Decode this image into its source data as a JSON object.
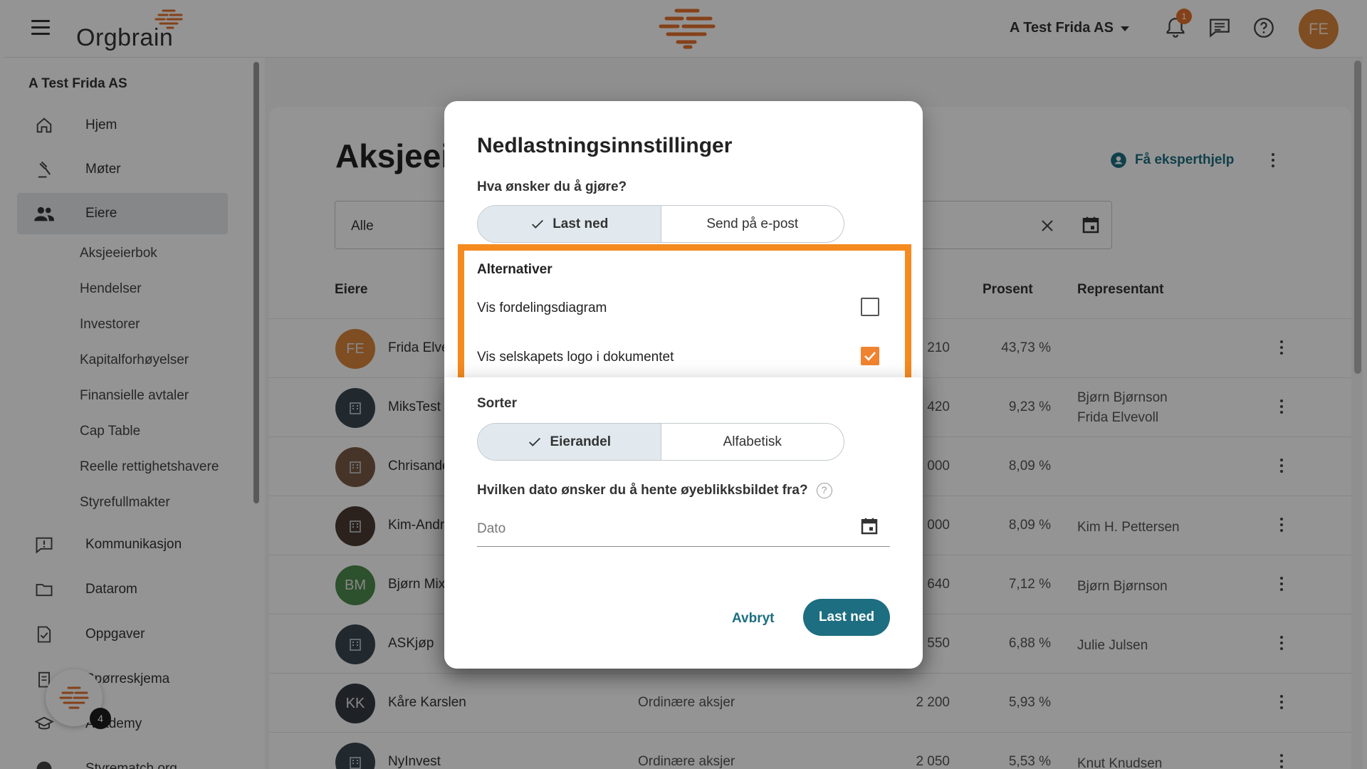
{
  "topbar": {
    "logo_text": "Orgbrain",
    "company": "A Test Frida AS",
    "notification_count": "1",
    "user_initials": "FE"
  },
  "sidebar": {
    "company": "A Test Frida AS",
    "items": [
      {
        "label": "Hjem",
        "icon": "home-icon"
      },
      {
        "label": "Møter",
        "icon": "gavel-icon"
      },
      {
        "label": "Eiere",
        "icon": "people-icon"
      }
    ],
    "sub_items": [
      "Aksjeeierbok",
      "Hendelser",
      "Investorer",
      "Kapitalforhøyelser",
      "Finansielle avtaler",
      "Cap Table",
      "Reelle rettighetshavere",
      "Styrefullmakter"
    ],
    "lower_items": [
      {
        "label": "Kommunikasjon",
        "icon": "alert-chat-icon"
      },
      {
        "label": "Datarom",
        "icon": "folder-icon"
      },
      {
        "label": "Oppgaver",
        "icon": "task-icon"
      },
      {
        "label": "Spørreskjema",
        "icon": "survey-icon"
      },
      {
        "label": "Academy",
        "icon": "school-icon"
      },
      {
        "label": "Styrematch.org",
        "icon": "styrematch-icon"
      }
    ],
    "fab_badge": "4"
  },
  "main": {
    "title": "Aksjeeie",
    "expert_help": "Få eksperthjelp",
    "filter_value": "Alle",
    "columns": {
      "owners": "Eiere",
      "percent": "Prosent",
      "representative": "Representant"
    },
    "rows": [
      {
        "initials": "FE",
        "avatar_color": "#d9853b",
        "name": "Frida Elve",
        "type": "",
        "shares": "210",
        "percent": "43,73 %",
        "rep": ""
      },
      {
        "initials": "",
        "avatar_color": "#3a4650",
        "name": "MiksTest",
        "type": "",
        "shares": "420",
        "percent": "9,23 %",
        "rep": "Bjørn Bjørnson",
        "rep2": "Frida Elvevoll"
      },
      {
        "initials": "",
        "avatar_color": "#7a5a45",
        "name": "Chrisande",
        "type": "",
        "shares": "000",
        "percent": "8,09 %",
        "rep": ""
      },
      {
        "initials": "",
        "avatar_color": "#4a3a32",
        "name": "Kim-Andr",
        "type": "",
        "shares": "000",
        "percent": "8,09 %",
        "rep": "Kim H. Pettersen"
      },
      {
        "initials": "BM",
        "avatar_color": "#4e8a4e",
        "name": "Bjørn Mix",
        "type": "",
        "shares": "640",
        "percent": "7,12 %",
        "rep": "Bjørn Bjørnson"
      },
      {
        "initials": "",
        "avatar_color": "#3a4650",
        "name": "ASKjøp",
        "type": "",
        "shares": "550",
        "percent": "6,88 %",
        "rep": "Julie Julsen"
      },
      {
        "initials": "KK",
        "avatar_color": "#343c44",
        "name": "Kåre Karslen",
        "type": "Ordinære aksjer",
        "shares": "2 200",
        "percent": "5,93 %",
        "rep": ""
      },
      {
        "initials": "",
        "avatar_color": "#3a4650",
        "name": "NyInvest",
        "type": "Ordinære aksjer",
        "shares": "2 050",
        "percent": "5,53 %",
        "rep": "Knut Knudsen"
      }
    ]
  },
  "dialog": {
    "title": "Nedlastningsinnstillinger",
    "question": "Hva ønsker du å gjøre?",
    "action_options": [
      "Last ned",
      "Send på e-post"
    ],
    "options_heading": "Alternativer",
    "option_1": "Vis fordelingsdiagram",
    "option_1_checked": false,
    "option_2": "Vis selskapets logo i dokumentet",
    "option_2_checked": true,
    "sort_heading": "Sorter",
    "sort_options": [
      "Eierandel",
      "Alfabetisk"
    ],
    "date_question": "Hvilken dato ønsker du å hente øyeblikksbildet fra?",
    "date_placeholder": "Dato",
    "cancel": "Avbryt",
    "confirm": "Last ned"
  },
  "colors": {
    "accent": "#1d6e80",
    "brand_orange": "#e3702b",
    "highlight": "#f58a1f"
  }
}
